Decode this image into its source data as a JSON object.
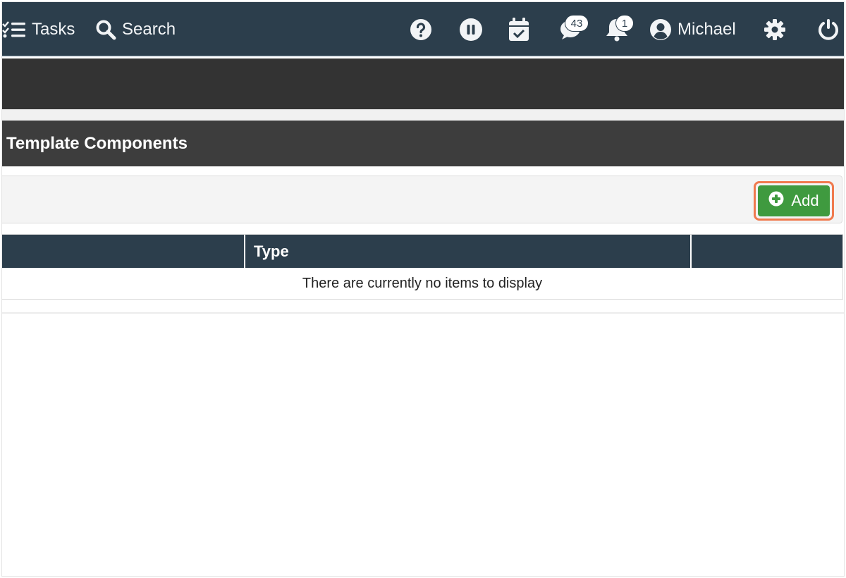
{
  "topnav": {
    "tasks_label": "Tasks",
    "search_label": "Search",
    "messages_count": "43",
    "notifications_count": "1",
    "user_name": "Michael",
    "icons": {
      "tasks": "tasks-list-icon",
      "search": "search-icon",
      "help": "question-circle-icon",
      "pause": "pause-circle-icon",
      "calendar": "calendar-check-icon",
      "messages": "comment-icon",
      "notifications": "bell-icon",
      "user": "user-circle-icon",
      "settings": "gear-icon",
      "power": "power-icon"
    }
  },
  "panel": {
    "title": "Template Components"
  },
  "toolbar": {
    "add_label": "Add",
    "add_icon": "plus-circle-icon"
  },
  "table": {
    "columns": [
      "",
      "Type",
      ""
    ],
    "empty_message": "There are currently no items to display"
  },
  "colors": {
    "nav_bg": "#2c3e4c",
    "banner_bg": "#333333",
    "panel_header_bg": "#3d3d3d",
    "add_button_bg": "#3f9a3f",
    "highlight": "#f07a4e"
  }
}
